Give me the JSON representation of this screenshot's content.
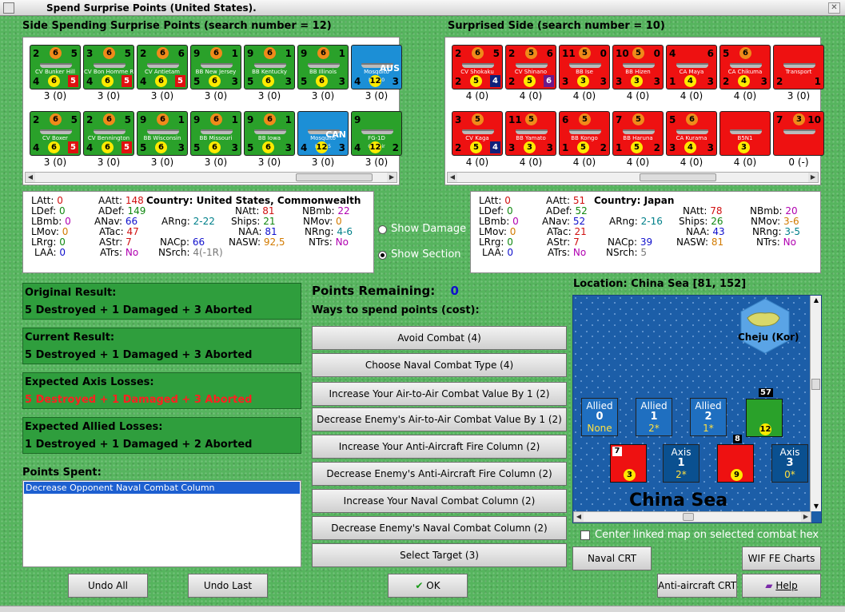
{
  "window": {
    "title": "Spend Surprise Points (United States)."
  },
  "left": {
    "heading": "Side Spending Surprise Points (search number = 12)",
    "row1": [
      {
        "name": "CV Bunker Hill",
        "tl": "2",
        "circ": "6",
        "tr": "5",
        "bl": "4",
        "cy": "6",
        "br": "5",
        "count": "3 (0)",
        "color": "green",
        "sq": "red"
      },
      {
        "name": "CV Bon Homme Richard",
        "tl": "3",
        "circ": "6",
        "tr": "5",
        "bl": "4",
        "cy": "6",
        "br": "5",
        "count": "3 (0)",
        "color": "green",
        "sq": "red"
      },
      {
        "name": "CV Antietam",
        "tl": "2",
        "circ": "6",
        "tr": "6",
        "bl": "4",
        "cy": "6",
        "br": "5",
        "count": "3 (0)",
        "color": "green",
        "sq": "red"
      },
      {
        "name": "BB New Jersey",
        "tl": "9",
        "circ": "6",
        "tr": "1",
        "bl": "5",
        "cy": "6",
        "br": "3",
        "count": "3 (0)",
        "color": "green",
        "sq": "none"
      },
      {
        "name": "BB Kentucky",
        "tl": "9",
        "circ": "6",
        "tr": "1",
        "bl": "5",
        "cy": "6",
        "br": "3",
        "count": "3 (0)",
        "color": "green",
        "sq": "none"
      },
      {
        "name": "BB Illinois",
        "tl": "9",
        "circ": "6",
        "tr": "1",
        "bl": "5",
        "cy": "6",
        "br": "3",
        "count": "3 (0)",
        "color": "green",
        "sq": "none"
      },
      {
        "name": "Mosquito",
        "sub": "Mk. 40",
        "tag": "AUS",
        "tl": "",
        "circ": "",
        "tr": "",
        "bl": "4",
        "cy": "12",
        "br": "3",
        "count": "3 (0)",
        "color": "blue",
        "sq": "none"
      }
    ],
    "row2": [
      {
        "name": "CV Boxer",
        "tl": "2",
        "circ": "6",
        "tr": "5",
        "bl": "4",
        "cy": "6",
        "br": "5",
        "count": "3 (0)",
        "color": "green",
        "sq": "red"
      },
      {
        "name": "CV Bennington",
        "tl": "2",
        "circ": "6",
        "tr": "5",
        "bl": "4",
        "cy": "6",
        "br": "5",
        "count": "3 (0)",
        "color": "green",
        "sq": "red"
      },
      {
        "name": "BB Wisconsin",
        "tl": "9",
        "circ": "6",
        "tr": "1",
        "bl": "5",
        "cy": "6",
        "br": "3",
        "count": "3 (0)",
        "color": "green",
        "sq": "none"
      },
      {
        "name": "BB Missouri",
        "tl": "9",
        "circ": "6",
        "tr": "1",
        "bl": "5",
        "cy": "6",
        "br": "3",
        "count": "3 (0)",
        "color": "green",
        "sq": "none"
      },
      {
        "name": "BB Iowa",
        "tl": "9",
        "circ": "6",
        "tr": "1",
        "bl": "5",
        "cy": "6",
        "br": "3",
        "count": "3 (0)",
        "color": "green",
        "sq": "none"
      },
      {
        "name": "Mosquito",
        "sub": "Mk. 25",
        "tag": "CAN",
        "tl": "",
        "circ": "",
        "tr": "",
        "bl": "4",
        "cy": "12",
        "br": "3",
        "count": "3 (0)",
        "color": "blue",
        "sq": "none"
      },
      {
        "name": "FG-1D",
        "sub": "Corsair",
        "tag": "",
        "tl": "9",
        "circ": "",
        "tr": "",
        "bl": "4",
        "cy": "12",
        "br": "2",
        "count": "3 (0)",
        "color": "green",
        "sq": "none"
      }
    ]
  },
  "right": {
    "heading": "Surprised Side (search number = 10)",
    "row1": [
      {
        "name": "CV Shokaku",
        "tl": "2",
        "circ": "6",
        "tr": "5",
        "bl": "2",
        "cy": "5",
        "br": "4",
        "count": "4 (0)",
        "color": "red",
        "sq": "navy"
      },
      {
        "name": "CV Shinano",
        "tl": "2",
        "circ": "5",
        "tr": "6",
        "bl": "2",
        "cy": "5",
        "br": "6",
        "count": "4 (0)",
        "color": "red",
        "sq": "purple"
      },
      {
        "name": "BB Ise",
        "tl": "11",
        "circ": "5",
        "tr": "0",
        "bl": "3",
        "cy": "3",
        "br": "3",
        "count": "4 (0)",
        "color": "red",
        "sq": "none"
      },
      {
        "name": "BB Hizen",
        "tl": "10",
        "circ": "5",
        "tr": "0",
        "bl": "3",
        "cy": "3",
        "br": "3",
        "count": "4 (0)",
        "color": "red",
        "sq": "none"
      },
      {
        "name": "CA Maya",
        "tl": "4",
        "circ": "",
        "tr": "6",
        "bl": "1",
        "cy": "4",
        "br": "3",
        "count": "4 (0)",
        "color": "red",
        "sq": "none"
      },
      {
        "name": "CA Chikuma",
        "tl": "5",
        "circ": "6",
        "tr": "",
        "bl": "2",
        "cy": "4",
        "br": "3",
        "count": "4 (0)",
        "color": "red",
        "sq": "none"
      },
      {
        "name": "Transport",
        "tl": "",
        "circ": "",
        "tr": "",
        "bl": "2",
        "cy": "",
        "br": "1",
        "count": "3 (0)",
        "color": "red",
        "sq": "none"
      }
    ],
    "row2": [
      {
        "name": "CV Kaga",
        "tl": "3",
        "circ": "5",
        "tr": "",
        "bl": "2",
        "cy": "5",
        "br": "4",
        "count": "4 (0)",
        "color": "red",
        "sq": "navy"
      },
      {
        "name": "BB Yamato",
        "tl": "11",
        "circ": "5",
        "tr": "",
        "bl": "3",
        "cy": "3",
        "br": "3",
        "count": "4 (0)",
        "color": "red",
        "sq": "none"
      },
      {
        "name": "BB Kongo",
        "tl": "6",
        "circ": "5",
        "tr": "",
        "bl": "1",
        "cy": "5",
        "br": "2",
        "count": "4 (0)",
        "color": "red",
        "sq": "none"
      },
      {
        "name": "BB Haruna",
        "tl": "7",
        "circ": "5",
        "tr": "",
        "bl": "1",
        "cy": "5",
        "br": "2",
        "count": "4 (0)",
        "color": "red",
        "sq": "none"
      },
      {
        "name": "CA Kurama",
        "tl": "5",
        "circ": "6",
        "tr": "",
        "bl": "3",
        "cy": "4",
        "br": "3",
        "count": "4 (0)",
        "color": "red",
        "sq": "none"
      },
      {
        "name": "B5N1",
        "tl": "",
        "circ": "",
        "tr": "",
        "bl": "",
        "cy": "3",
        "br": "",
        "count": "4 (0)",
        "color": "red",
        "sq": "none"
      },
      {
        "name": "",
        "tl": "7",
        "circ": "3",
        "tr": "10",
        "bl": "",
        "cy": "",
        "br": "",
        "count": "0 (-)",
        "color": "red",
        "sq": "none"
      }
    ]
  },
  "us_stats": {
    "LAtt": "0",
    "LDef": "0",
    "LBmb": "0",
    "LMov": "0",
    "LRrg": "0",
    "LAA": "0",
    "AAtt": "148",
    "ADef": "149",
    "ANav": "66",
    "ATac": "47",
    "AStr": "7",
    "ATrs": "No",
    "country_label": "Country:",
    "country": "United States, Commonwealth",
    "ARng": "2-22",
    "NACp": "66",
    "NSrch": "4(-1R)",
    "NAtt": "81",
    "Ships": "21",
    "NAA": "81",
    "NASW": "92,5",
    "NBmb": "22",
    "NMov": "0",
    "NRng": "4-6",
    "NTrs": "No"
  },
  "jp_stats": {
    "LAtt": "0",
    "LDef": "0",
    "LBmb": "0",
    "LMov": "0",
    "LRrg": "0",
    "LAA": "0",
    "AAtt": "51",
    "ADef": "52",
    "ANav": "52",
    "ATac": "21",
    "AStr": "7",
    "ATrs": "No",
    "country_label": "Country:",
    "country": "Japan",
    "ARng": "2-16",
    "NACp": "39",
    "NSrch": "5",
    "NAtt": "78",
    "Ships": "26",
    "NAA": "43",
    "NASW": "81",
    "NBmb": "20",
    "NMov": "3-6",
    "NRng": "3-5",
    "NTrs": "No"
  },
  "labels": {
    "LAtt": "LAtt:",
    "LDef": "LDef:",
    "LBmb": "LBmb:",
    "LMov": "LMov:",
    "LRrg": "LRrg:",
    "LAA": "LAA:",
    "AAtt": "AAtt:",
    "ADef": "ADef:",
    "ANav": "ANav:",
    "ATac": "ATac:",
    "AStr": "AStr:",
    "ATrs": "ATrs:",
    "ARng": "ARng:",
    "NACp": "NACp:",
    "NSrch": "NSrch:",
    "NAtt": "NAtt:",
    "Ships": "Ships:",
    "NAA": "NAA:",
    "NASW": "NASW:",
    "NBmb": "NBmb:",
    "NMov": "NMov:",
    "NRng": "NRng:",
    "NTrs": "NTrs:"
  },
  "toggles": {
    "show_damage": "Show Damage",
    "show_section": "Show Section",
    "selected": "show_section"
  },
  "results": {
    "original_h": "Original Result:",
    "original": "5 Destroyed + 1 Damaged + 3 Aborted",
    "current_h": "Current Result:",
    "current": "5 Destroyed + 1 Damaged + 3 Aborted",
    "axis_h": "Expected Axis Losses:",
    "axis": "5 Destroyed + 1 Damaged + 3 Aborted",
    "allied_h": "Expected Allied Losses:",
    "allied": "1 Destroyed + 1 Damaged + 2 Aborted"
  },
  "points": {
    "spent_label": "Points Spent:",
    "spent_items": [
      "Decrease Opponent Naval Combat Column"
    ],
    "remaining_label": "Points Remaining:",
    "remaining": "0",
    "ways_label": "Ways to spend points (cost):"
  },
  "options": [
    "Avoid Combat (4)",
    "Choose Naval Combat Type (4)",
    "Increase Your Air-to-Air Combat Value By 1 (2)",
    "Decrease Enemy's Air-to-Air Combat Value By 1 (2)",
    "Increase Your Anti-Aircraft Fire Column (2)",
    "Decrease Enemy's Anti-Aircraft Fire Column (2)",
    "Increase Your Naval Combat Column (2)",
    "Decrease Enemy's Naval Combat Column (2)",
    "Select Target (3)"
  ],
  "map": {
    "location": "Location: China Sea [81, 152]",
    "hex_label": "Cheju (Kor)",
    "sea_label": "China Sea",
    "allied_boxes": [
      {
        "t": "Allied",
        "n": "0",
        "s": "None"
      },
      {
        "t": "Allied",
        "n": "1",
        "s": "2*"
      },
      {
        "t": "Allied",
        "n": "2",
        "s": "1*"
      }
    ],
    "axis_boxes": [
      {
        "t": "Axis",
        "n": "1",
        "s": "2*"
      },
      {
        "t": "Axis",
        "n": "3",
        "s": "0*"
      }
    ],
    "stack1": "57",
    "stack2": "8",
    "center_label": "Center linked map on selected combat hex"
  },
  "buttons": {
    "undo_all": "Undo All",
    "undo_last": "Undo Last",
    "ok": "OK",
    "naval_crt": "Naval CRT",
    "wif_charts": "WIF FE Charts",
    "aa_crt": "Anti-aircraft CRT",
    "help": "Help"
  },
  "colors": {
    "green_unit": "#2aa12a",
    "red_unit": "#ee1111",
    "result_bg": "#2f9e3d",
    "sea": "#1c5ea8",
    "axis_loss_text": "#ff2020"
  }
}
